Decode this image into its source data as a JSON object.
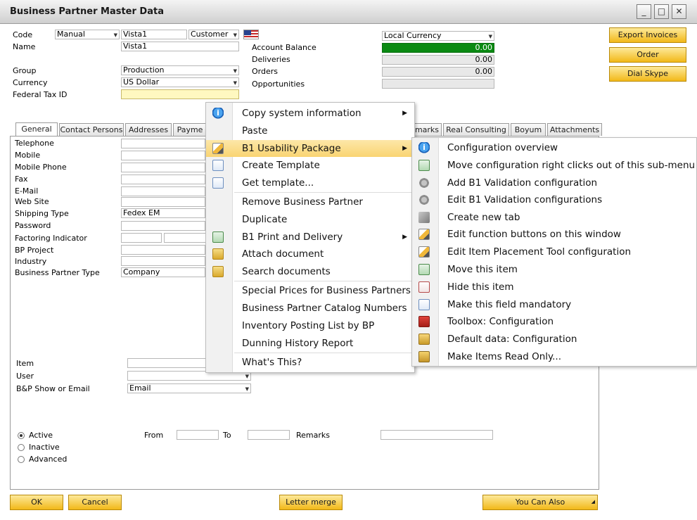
{
  "window": {
    "title": "Business Partner Master Data"
  },
  "header": {
    "code_label": "Code",
    "code_series": "Manual",
    "code_value": "Vista1",
    "bp_kind": "Customer",
    "name_label": "Name",
    "name_value": "Vista1",
    "group_label": "Group",
    "group_value": "Production",
    "currency_label": "Currency",
    "currency_value": "US Dollar",
    "fed_tax_label": "Federal Tax ID",
    "fed_tax_value": "",
    "local_currency": "Local Currency",
    "account_balance_label": "Account Balance",
    "account_balance_value": "0.00",
    "deliveries_label": "Deliveries",
    "deliveries_value": "0.00",
    "orders_label": "Orders",
    "orders_value": "0.00",
    "opportunities_label": "Opportunities"
  },
  "side_buttons": {
    "export_invoices": "Export Invoices",
    "order": "Order",
    "dial_skype": "Dial Skype"
  },
  "tabs": [
    "General",
    "Contact Persons",
    "Addresses",
    "Payme",
    "marks",
    "Real Consulting",
    "Boyum",
    "Attachments"
  ],
  "general": {
    "labels": [
      "Telephone",
      "Mobile",
      "Mobile Phone",
      "Fax",
      "E-Mail",
      "Web Site",
      "Shipping Type",
      "Password",
      "Factoring Indicator",
      "BP Project",
      "Industry",
      "Business Partner Type"
    ],
    "shipping_type": "Fedex EM",
    "bp_type": "Company",
    "item_label": "Item",
    "user_label": "User",
    "show_email_label": "B&P Show or Email",
    "show_email_value": "Email",
    "active": "Active",
    "inactive": "Inactive",
    "advanced": "Advanced",
    "from": "From",
    "to": "To",
    "remarks": "Remarks"
  },
  "footer": {
    "ok": "OK",
    "cancel": "Cancel",
    "letter_merge": "Letter merge",
    "you_can_also": "You Can Also"
  },
  "context_menu": {
    "items": [
      "Copy system information",
      "Paste",
      "B1 Usability Package",
      "Create Template",
      "Get template...",
      "Remove Business Partner",
      "Duplicate",
      "B1 Print and Delivery",
      "Attach document",
      "Search documents",
      "Special Prices for Business Partners",
      "Business Partner Catalog Numbers",
      "Inventory Posting List by BP",
      "Dunning History Report",
      "What's This?"
    ]
  },
  "submenu": {
    "items": [
      "Configuration overview",
      "Move configuration right clicks out of this sub-menu",
      "Add B1 Validation configuration",
      "Edit B1 Validation configurations",
      "Create new tab",
      "Edit function buttons on this window",
      "Edit Item Placement Tool configuration",
      "Move this item",
      "Hide this item",
      "Make this field mandatory",
      "Toolbox: Configuration",
      "Default data: Configuration",
      "Make Items Read Only..."
    ]
  }
}
